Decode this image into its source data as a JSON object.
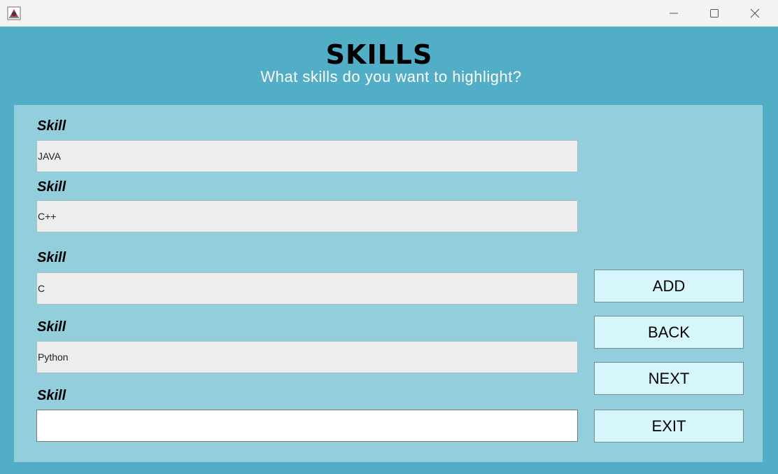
{
  "window": {
    "icons": {
      "app": "java-app-icon",
      "minimize": "minimize-icon",
      "maximize": "maximize-icon",
      "close": "close-icon"
    }
  },
  "header": {
    "title": "SKILLS",
    "subtitle": "What skills do you want to highlight?"
  },
  "form": {
    "fields": [
      {
        "label": "Skill",
        "value": "JAVA"
      },
      {
        "label": "Skill",
        "value": "C++"
      },
      {
        "label": "Skill",
        "value": "C"
      },
      {
        "label": "Skill",
        "value": "Python"
      },
      {
        "label": "Skill",
        "value": ""
      }
    ]
  },
  "buttons": {
    "add": "ADD",
    "back": "BACK",
    "next": "NEXT",
    "exit": "EXIT"
  },
  "colors": {
    "window_bg": "#52aec6",
    "panel_bg": "#93cedd",
    "field_bg": "#eeeded",
    "button_bg": "#d6f6fc",
    "subtitle": "#ffffff"
  }
}
